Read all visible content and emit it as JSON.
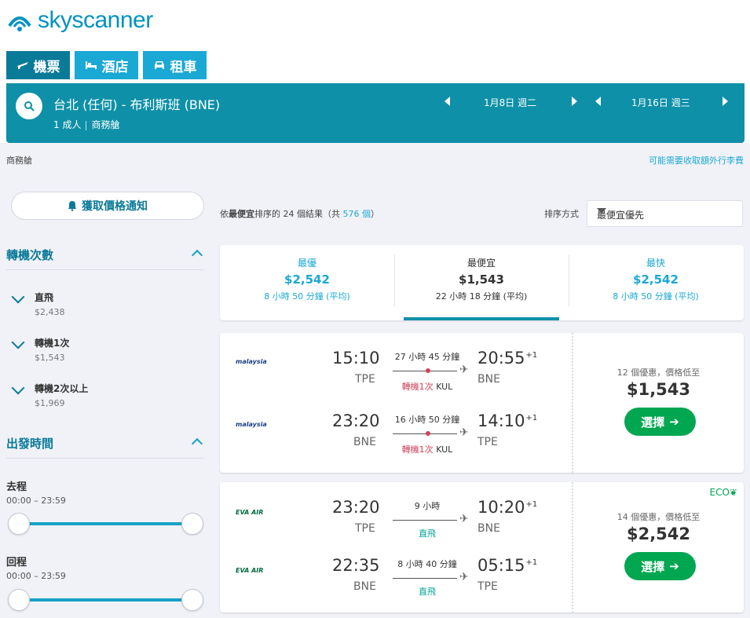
{
  "brand": {
    "logo_text": "skyscanner"
  },
  "tabs": [
    {
      "label": "機票",
      "icon": "plane-icon",
      "active": true
    },
    {
      "label": "酒店",
      "icon": "bed-icon",
      "active": false
    },
    {
      "label": "租車",
      "icon": "car-icon",
      "active": false
    }
  ],
  "search": {
    "route": "台北 (任何) - 布利斯班 (BNE)",
    "passengers": "1 成人",
    "cabin": "商務艙",
    "outbound_date": "1月8日 週二",
    "return_date": "1月16日 週三"
  },
  "subheader": {
    "cabin_left": "商務艙",
    "baggage_link": "可能需要收取額外行李費"
  },
  "price_alert": {
    "label": "獲取價格通知"
  },
  "filters": {
    "stops": {
      "title": "轉機次數",
      "options": [
        {
          "label": "直飛",
          "price": "$2,438",
          "checked": true
        },
        {
          "label": "轉機1次",
          "price": "$1,543",
          "checked": true
        },
        {
          "label": "轉機2次以上",
          "price": "$1,969",
          "checked": true
        }
      ]
    },
    "departure_time": {
      "title": "出發時間",
      "outbound": {
        "label": "去程",
        "range": "00:00 – 23:59",
        "min_fraction": 0.0,
        "max_fraction": 1.0
      },
      "return": {
        "label": "回程",
        "range": "00:00 – 23:59",
        "min_fraction": 0.0,
        "max_fraction": 1.0
      }
    }
  },
  "results_bar": {
    "prefix": "依",
    "sort_word": "最便宜",
    "middle": "排序的 24 個結果（共 ",
    "total_link": "576 個",
    "suffix": "）",
    "sort_label": "排序方式",
    "sort_value": "最便宜優先"
  },
  "summary": [
    {
      "label": "最優",
      "price": "$2,542",
      "duration": "8 小時 50 分鐘 (平均)",
      "selected": false
    },
    {
      "label": "最便宜",
      "price": "$1,543",
      "duration": "22 小時 18 分鐘 (平均)",
      "selected": true
    },
    {
      "label": "最快",
      "price": "$2,542",
      "duration": "8 小時 50 分鐘 (平均)",
      "selected": false
    }
  ],
  "results": [
    {
      "legs": [
        {
          "airline": "malaysia",
          "dep_time": "15:10",
          "dep_ap": "TPE",
          "arr_time": "20:55",
          "arr_plus": "+1",
          "arr_ap": "BNE",
          "duration": "27 小時 45 分鐘",
          "stop_count": "轉機1次",
          "stop_ap": "KUL"
        },
        {
          "airline": "malaysia",
          "dep_time": "23:20",
          "dep_ap": "BNE",
          "arr_time": "14:10",
          "arr_plus": "+1",
          "arr_ap": "TPE",
          "duration": "16 小時 50 分鐘",
          "stop_count": "轉機1次",
          "stop_ap": "KUL"
        }
      ],
      "deals": "12 個優惠，價格低至",
      "price": "$1,543",
      "select_label": "選擇"
    },
    {
      "eco": "ECO",
      "legs": [
        {
          "airline": "EVA AIR",
          "dep_time": "23:20",
          "dep_ap": "TPE",
          "arr_time": "10:20",
          "arr_plus": "+1",
          "arr_ap": "BNE",
          "duration": "9 小時",
          "stop_count": "直飛"
        },
        {
          "airline": "EVA AIR",
          "dep_time": "22:35",
          "dep_ap": "BNE",
          "arr_time": "05:15",
          "arr_plus": "+1",
          "arr_ap": "TPE",
          "duration": "8 小時 40 分鐘",
          "stop_count": "直飛"
        }
      ],
      "deals": "14 個優惠，價格低至",
      "price": "$2,542",
      "select_label": "選擇"
    }
  ],
  "colors": {
    "brand_teal": "#0e90a8",
    "tab_blue": "#1aa8d5",
    "accent_green": "#00a650",
    "stop_red": "#d1435b"
  }
}
